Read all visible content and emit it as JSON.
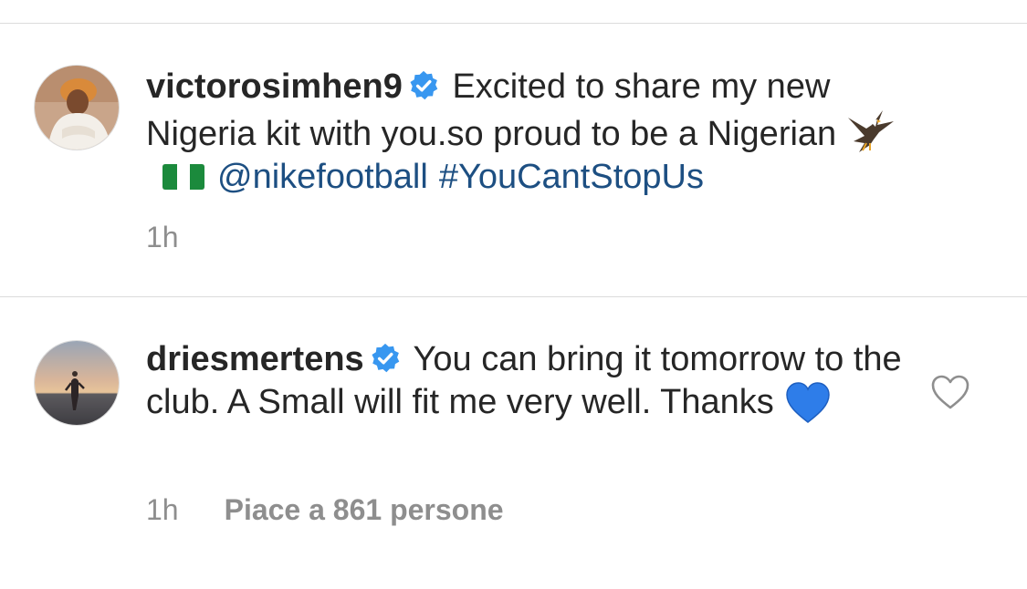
{
  "comments": [
    {
      "username": "victorosimhen9",
      "verified": true,
      "text": "Excited to share my new Nigeria kit with you.so proud to be a Nigerian",
      "emojis": [
        "eagle",
        "nigeria-flag"
      ],
      "mention": "@nikefootball",
      "hashtag": "#YouCantStopUs",
      "time": "1h"
    },
    {
      "username": "driesmertens",
      "verified": true,
      "text": "You can bring it tomorrow to the club. A Small will fit me very well. Thanks",
      "emojis": [
        "blue-heart"
      ],
      "time": "1h",
      "likes": "Piace a 861 persone",
      "like_icon": "heart-outline-icon"
    }
  ],
  "colors": {
    "text": "#262626",
    "secondary": "#8e8e8e",
    "link": "#1d4f82",
    "verified": "#3897f0",
    "divider": "#dbdbdb",
    "blue_heart": "#2e7de9"
  }
}
